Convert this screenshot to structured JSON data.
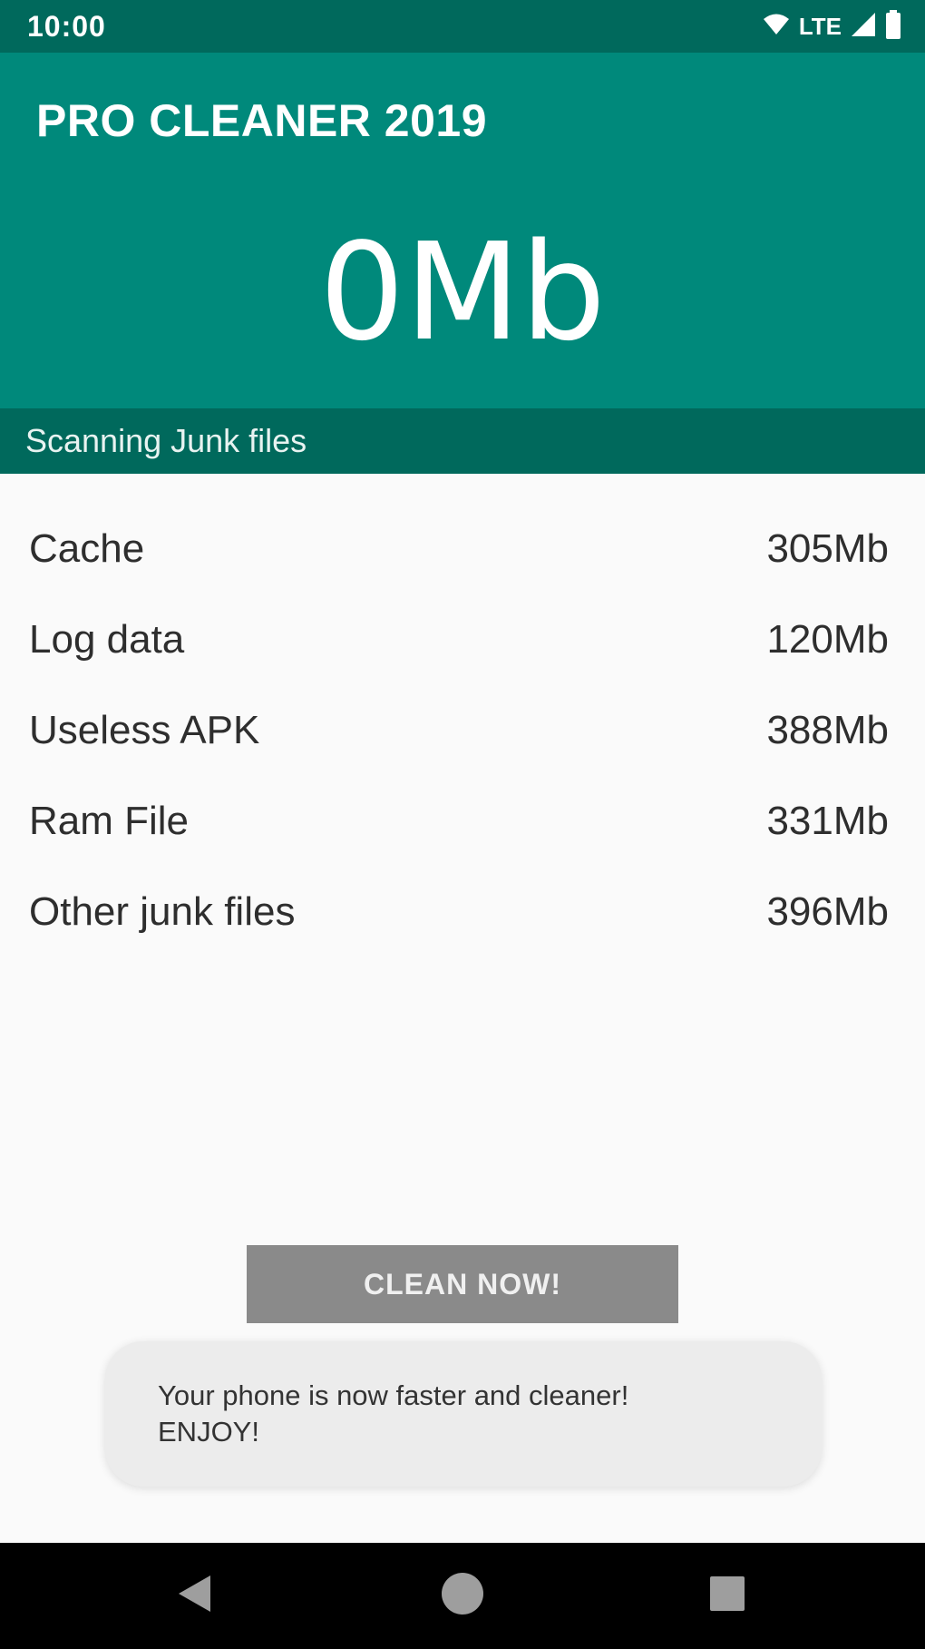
{
  "status_bar": {
    "time": "10:00",
    "network": "LTE",
    "icons": [
      "wifi-icon",
      "cell-signal-icon",
      "battery-icon"
    ]
  },
  "app_bar": {
    "title": "PRO CLEANER 2019",
    "total": "0Mb"
  },
  "scan_status": "Scanning Junk files",
  "junk_items": [
    {
      "label": "Cache",
      "size": "305Mb"
    },
    {
      "label": "Log data",
      "size": "120Mb"
    },
    {
      "label": "Useless APK",
      "size": "388Mb"
    },
    {
      "label": "Ram File",
      "size": "331Mb"
    },
    {
      "label": "Other junk files",
      "size": "396Mb"
    }
  ],
  "clean_button_label": "CLEAN NOW!",
  "toast": {
    "line1": "Your phone is now faster and cleaner!",
    "line2": "ENJOY!"
  },
  "nav_bar": {
    "icons": [
      "back-icon",
      "home-icon",
      "recents-icon"
    ]
  },
  "colors": {
    "primary": "#00897b",
    "primary_dark": "#00695c",
    "button_disabled": "#8a8a8a",
    "background": "#fafafa"
  }
}
